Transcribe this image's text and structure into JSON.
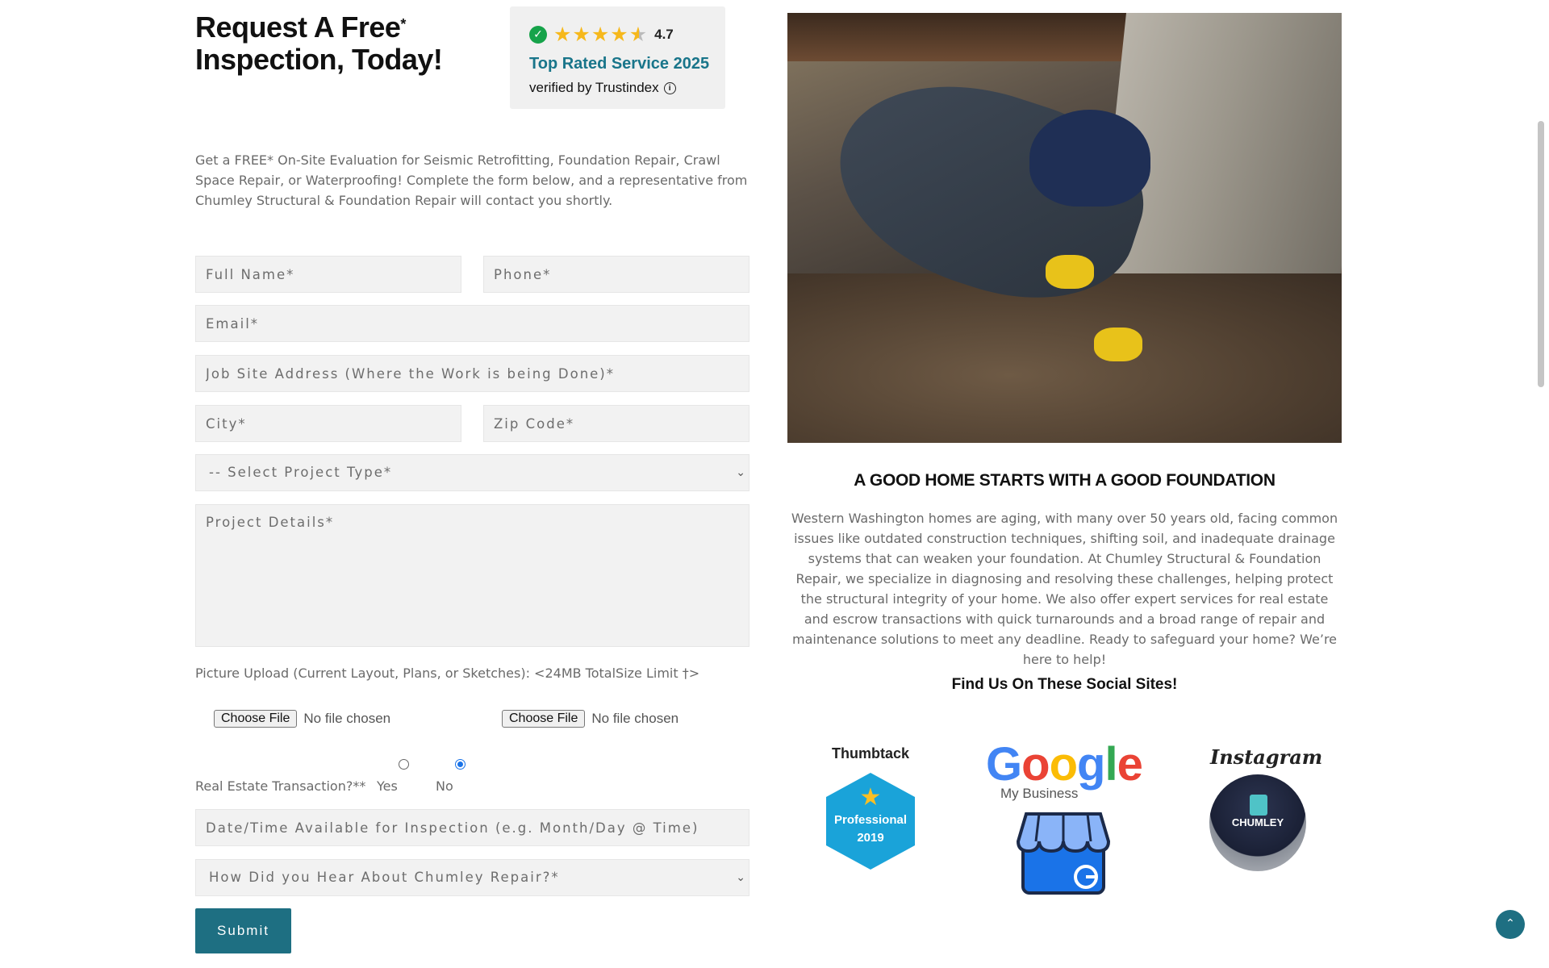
{
  "form": {
    "heading_line1": "Request A Free",
    "heading_sup": "*",
    "heading_line2": "Inspection, Today!",
    "intro": "Get a FREE* On-Site Evaluation for Seismic Retrofitting, Foundation Repair, Crawl Space Repair, or Waterproofing! Complete the form below, and a representative from Chumley Structural & Foundation Repair will contact you shortly.",
    "full_name_placeholder": "Full Name*",
    "phone_placeholder": "Phone*",
    "email_placeholder": "Email*",
    "address_placeholder": "Job Site Address (Where the Work is being Done)*",
    "city_placeholder": "City*",
    "zip_placeholder": "Zip Code*",
    "project_type_selected": "-- Select Project Type*",
    "details_placeholder": "Project Details*",
    "upload_label": "Picture Upload (Current Layout, Plans, or Sketches): <24MB TotalSize Limit †>",
    "choose_file_label": "Choose File",
    "no_file_text": "No file chosen",
    "real_estate_label": "Real Estate Transaction?**",
    "yes_label": "Yes",
    "no_label": "No",
    "real_estate_selected": "No",
    "datetime_placeholder": "Date/Time Available for Inspection (e.g. Month/Day @ Time)",
    "referral_selected": "How Did you Hear About Chumley Repair?*",
    "submit_label": "Submit"
  },
  "trust_badge": {
    "rating": "4.7",
    "rating_value": 4.7,
    "title": "Top Rated Service 2025",
    "verified": "verified by Trustindex",
    "star_color": "#f6b81c",
    "title_color": "#19758a"
  },
  "about": {
    "tagline": "A GOOD HOME STARTS WITH A GOOD FOUNDATION",
    "body": "Western Washington homes are aging, with many over 50 years old, facing common issues like outdated construction techniques, shifting soil, and inadequate drainage systems that can weaken your foundation. At Chumley Structural & Foundation Repair, we specialize in diagnosing and resolving these challenges, helping protect the structural integrity of your home. We also offer expert services for real estate and escrow transactions with quick turnarounds and a broad range of repair and maintenance solutions to meet any deadline. Ready to safeguard your home? We’re here to help!",
    "social_title": "Find Us On These Social Sites!"
  },
  "social": {
    "thumbtack_label": "Thumbtack",
    "thumbtack_badge_line1": "Professional",
    "thumbtack_badge_line2": "2019",
    "google_word": "Google",
    "google_sub": "My Business",
    "instagram_label": "Instagram",
    "instagram_hat_text": "CHUMLEY"
  },
  "colors": {
    "accent": "#1e6f82",
    "field_bg": "#f2f2f2"
  },
  "icons": {
    "check": "check-circle-icon",
    "info": "info-icon",
    "chevron": "chevron-down-icon",
    "scroll_top": "chevron-up-icon"
  }
}
